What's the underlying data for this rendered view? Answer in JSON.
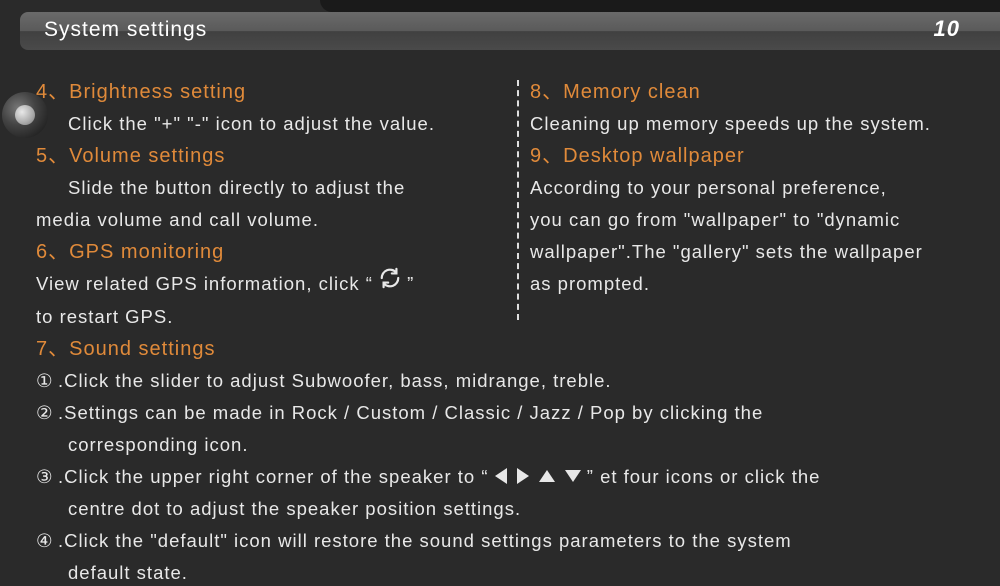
{
  "header": {
    "title": "System settings",
    "page_number": "10"
  },
  "left": {
    "s4": {
      "num": "4、",
      "title": "Brightness setting",
      "body": "Click the \"+\" \"-\" icon to adjust the value."
    },
    "s5": {
      "num": "5、",
      "title": "Volume settings",
      "body1": "Slide the button directly to adjust the",
      "body2": "media volume and call volume."
    },
    "s6": {
      "num": "6、",
      "title": "GPS monitoring",
      "body1": "View related GPS information, click  “",
      "body2": "” ",
      "body3": "to restart GPS."
    },
    "s7": {
      "num": "7、",
      "title": "Sound settings"
    }
  },
  "right": {
    "s8": {
      "num": "8、",
      "title": "Memory clean",
      "body": "Cleaning up memory speeds up the system."
    },
    "s9": {
      "num": "9、",
      "title": "Desktop wallpaper",
      "body1": "According to your personal preference,",
      "body2": "you can go from \"wallpaper\" to \"dynamic",
      "body3": "wallpaper\".The \"gallery\" sets the wallpaper",
      "body4": "as prompted."
    }
  },
  "sound": {
    "n1": "①",
    "t1": ".Click the slider to adjust Subwoofer, bass, midrange, treble.",
    "n2": "②",
    "t2a": ".Settings can be made in Rock / Custom / Classic / Jazz / Pop by clicking the",
    "t2b": "corresponding icon.",
    "n3": "③",
    "t3a": ".Click the upper right corner of the speaker to  “",
    "t3b": "”  et four icons or click the",
    "t3c": "centre dot to adjust the speaker position settings.",
    "n4": "④",
    "t4a": ".Click the \"default\" icon will restore the sound settings parameters to the system",
    "t4b": "default state."
  }
}
